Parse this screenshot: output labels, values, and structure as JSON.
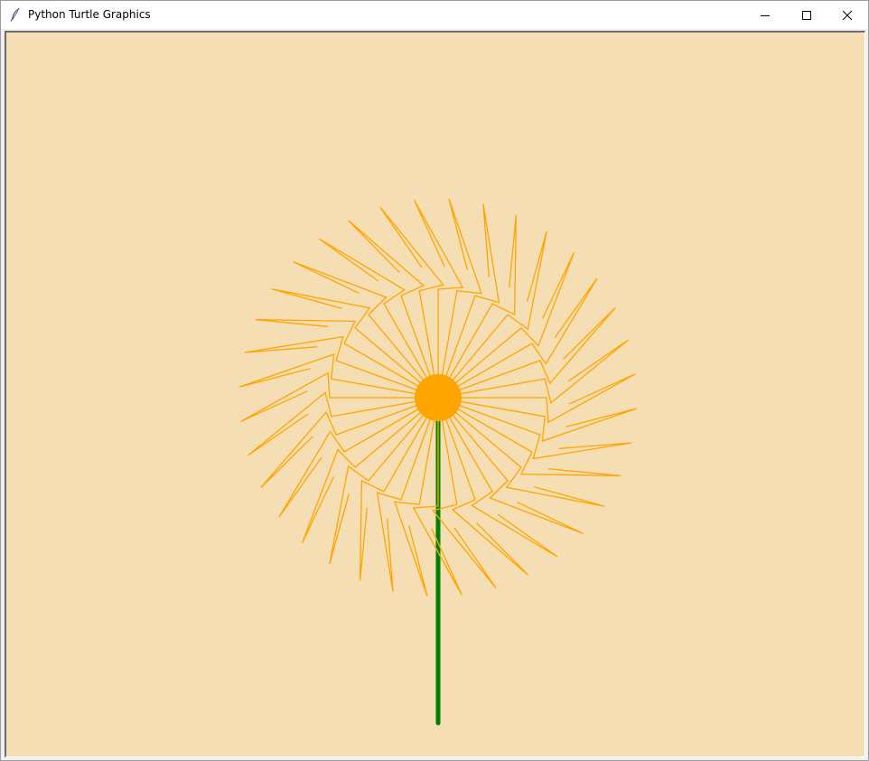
{
  "window": {
    "title": "Python Turtle Graphics",
    "icon": "feather-icon"
  },
  "controls": {
    "minimize_icon": "minimize-icon",
    "maximize_icon": "maximize-icon",
    "close_icon": "close-icon"
  },
  "canvas": {
    "background_color": "#f5deb3",
    "petal_color": "#ffa500",
    "center_color": "#ffa500",
    "stem_color": "#008000"
  }
}
